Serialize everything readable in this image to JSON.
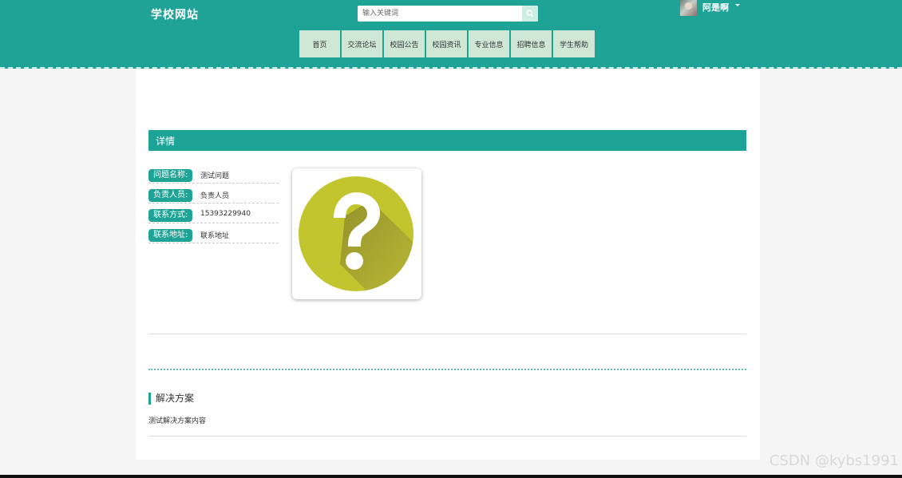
{
  "header": {
    "logo": "学校网站",
    "search": {
      "placeholder": "输入关键词",
      "value": ""
    },
    "user": {
      "name": "阿是啊"
    }
  },
  "nav": [
    {
      "label": "首页"
    },
    {
      "label": "交流论坛"
    },
    {
      "label": "校园公告"
    },
    {
      "label": "校园资讯"
    },
    {
      "label": "专业信息"
    },
    {
      "label": "招聘信息"
    },
    {
      "label": "学生帮助"
    }
  ],
  "detail": {
    "title": "详情",
    "fields": [
      {
        "label": "问题名称:",
        "value_prefix": "测",
        "value_selected": "试问题"
      },
      {
        "label": "负责人员:",
        "value": "负责人员"
      },
      {
        "label": "联系方式:",
        "value": "15393229940"
      },
      {
        "label": "联系地址:",
        "value": "联系地址"
      }
    ],
    "image_icon": "question-mark-icon"
  },
  "solution": {
    "title": "解决方案",
    "content": "测试解决方案内容"
  },
  "watermark": "CSDN @kybs1991",
  "colors": {
    "primary": "#1fa397",
    "nav_item": "#cfe7d5",
    "icon_yellow": "#c3c52f",
    "selection": "#3390ff"
  }
}
